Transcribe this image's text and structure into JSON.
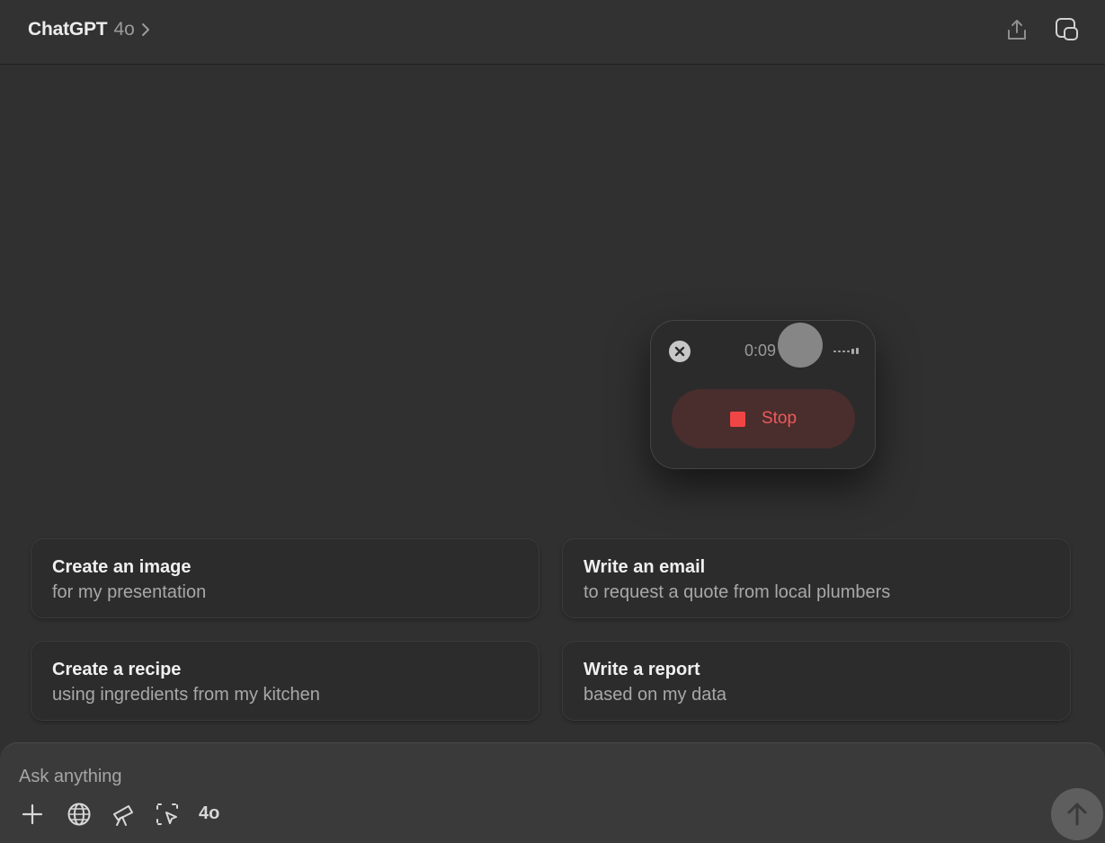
{
  "header": {
    "app_name": "ChatGPT",
    "model": "4o",
    "share_icon": "share-icon",
    "new_chat_icon": "new-chat-icon"
  },
  "recording": {
    "timer": "0:09",
    "stop_label": "Stop",
    "close_icon": "close-icon",
    "stop_color": "#f04545"
  },
  "suggestions": [
    {
      "title": "Create an image",
      "subtitle": "for my presentation"
    },
    {
      "title": "Write an email",
      "subtitle": "to request a quote from local plumbers"
    },
    {
      "title": "Create a recipe",
      "subtitle": "using ingredients from my kitchen"
    },
    {
      "title": "Write a report",
      "subtitle": "based on my data"
    }
  ],
  "composer": {
    "placeholder": "Ask anything",
    "model_label": "4o",
    "tools": [
      "plus-icon",
      "globe-icon",
      "telescope-icon",
      "screen-select-icon"
    ],
    "send_icon": "arrow-up-icon"
  },
  "colors": {
    "background": "#303030",
    "card": "#2c2c2c",
    "composer": "#3a3a3a"
  }
}
